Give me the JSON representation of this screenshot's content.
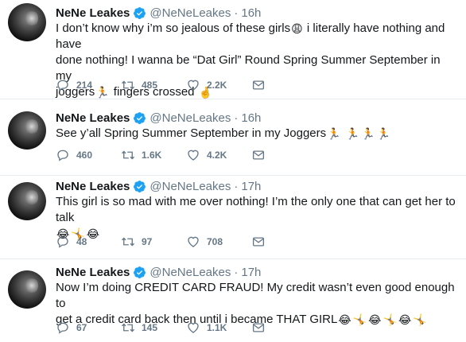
{
  "tweets": [
    {
      "name": "NeNe Leakes",
      "handle": "@NeNeLeakes",
      "time": "16h",
      "lines": [
        "I don’t know why i’m so jealous of these girls",
        " i literally have nothing and have",
        "done nothing! I wanna be “Dat Girl” Round Spring Summer September in my",
        "joggers",
        " fingers crossed "
      ],
      "replies": "214",
      "retweets": "485",
      "likes": "2.2K"
    },
    {
      "name": "NeNe Leakes",
      "handle": "@NeNeLeakes",
      "time": "16h",
      "lines": [
        "See y’all Spring Summer September in my Joggers"
      ],
      "replies": "460",
      "retweets": "1.6K",
      "likes": "4.2K"
    },
    {
      "name": "NeNe Leakes",
      "handle": "@NeNeLeakes",
      "time": "17h",
      "lines": [
        "This girl is so mad with me over nothing! I’m the only one that can get her to talk"
      ],
      "replies": "48",
      "retweets": "97",
      "likes": "708"
    },
    {
      "name": "NeNe Leakes",
      "handle": "@NeNeLeakes",
      "time": "17h",
      "lines": [
        "Now I’m doing CREDIT CARD FRAUD! My credit wasn’t even good enough to",
        "get a credit card back then until i became THAT GIRL"
      ],
      "replies": "67",
      "retweets": "145",
      "likes": "1.1K"
    }
  ],
  "icons": {
    "verified": "verified-badge-icon",
    "reply": "reply-icon",
    "retweet": "retweet-icon",
    "like": "heart-icon",
    "dm": "envelope-icon"
  },
  "colors": {
    "verified": "#1da1f2",
    "text": "#14171a",
    "muted": "#657786",
    "divider": "#e6ecf0"
  }
}
